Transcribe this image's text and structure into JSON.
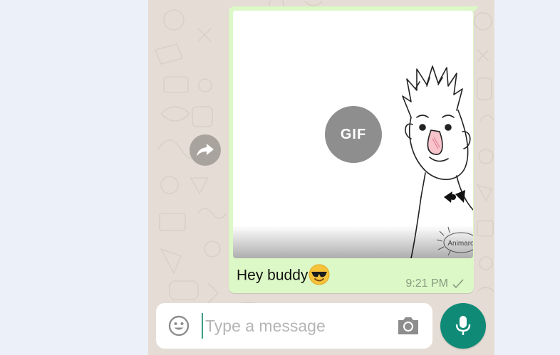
{
  "colors": {
    "wallpaper": "#e5ddd5",
    "outgoing_bubble": "#dcf8c6",
    "accent": "#0f8a77"
  },
  "message": {
    "media_badge": "GIF",
    "watermark": "Animaro",
    "caption": "Hey buddy",
    "caption_emoji": "smiling-face-with-sunglasses",
    "time": "9:21 PM",
    "status_icon": "single-check-icon"
  },
  "composer": {
    "placeholder": "Type a message",
    "value": "",
    "emoji_icon": "smiley-icon",
    "camera_icon": "camera-icon",
    "send_icon": "microphone-icon"
  },
  "actions": {
    "forward_icon": "forward-arrow-icon"
  }
}
